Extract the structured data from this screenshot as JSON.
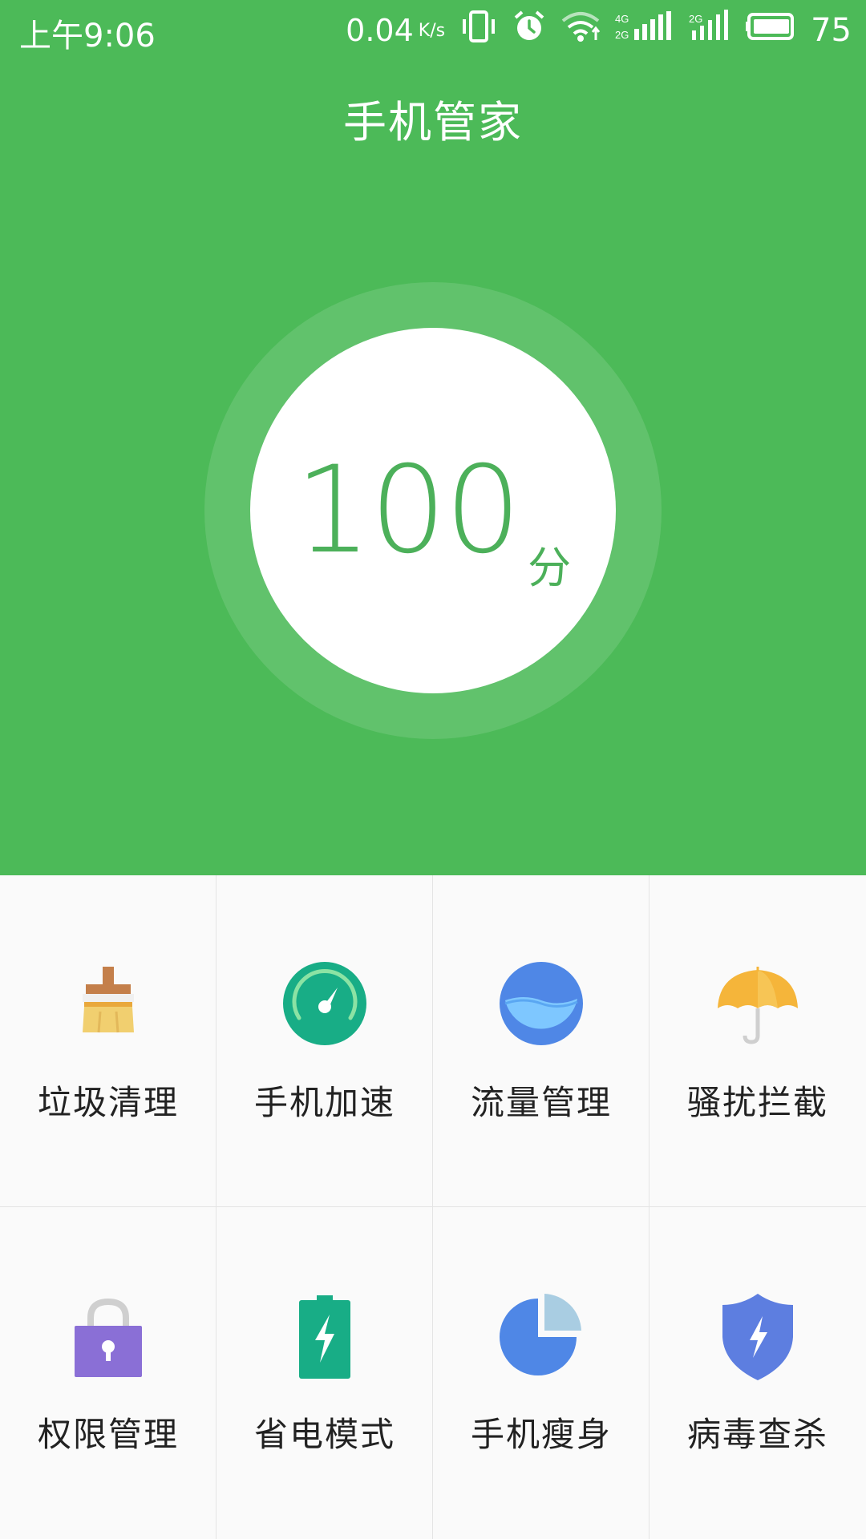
{
  "status_bar": {
    "time": "上午9:06",
    "speed": "0.04",
    "speed_unit": "K/s",
    "battery": "75"
  },
  "header": {
    "title": "手机管家"
  },
  "score": {
    "value": "100",
    "unit": "分"
  },
  "features": [
    {
      "label": "垃圾清理",
      "icon": "broom-icon"
    },
    {
      "label": "手机加速",
      "icon": "speedometer-icon"
    },
    {
      "label": "流量管理",
      "icon": "data-flow-icon"
    },
    {
      "label": "骚扰拦截",
      "icon": "umbrella-icon"
    },
    {
      "label": "权限管理",
      "icon": "lock-icon"
    },
    {
      "label": "省电模式",
      "icon": "battery-saver-icon"
    },
    {
      "label": "手机瘦身",
      "icon": "pie-chart-icon"
    },
    {
      "label": "病毒查杀",
      "icon": "shield-icon"
    }
  ],
  "colors": {
    "primary_green": "#4cba58",
    "score_green": "#4cb05a"
  }
}
